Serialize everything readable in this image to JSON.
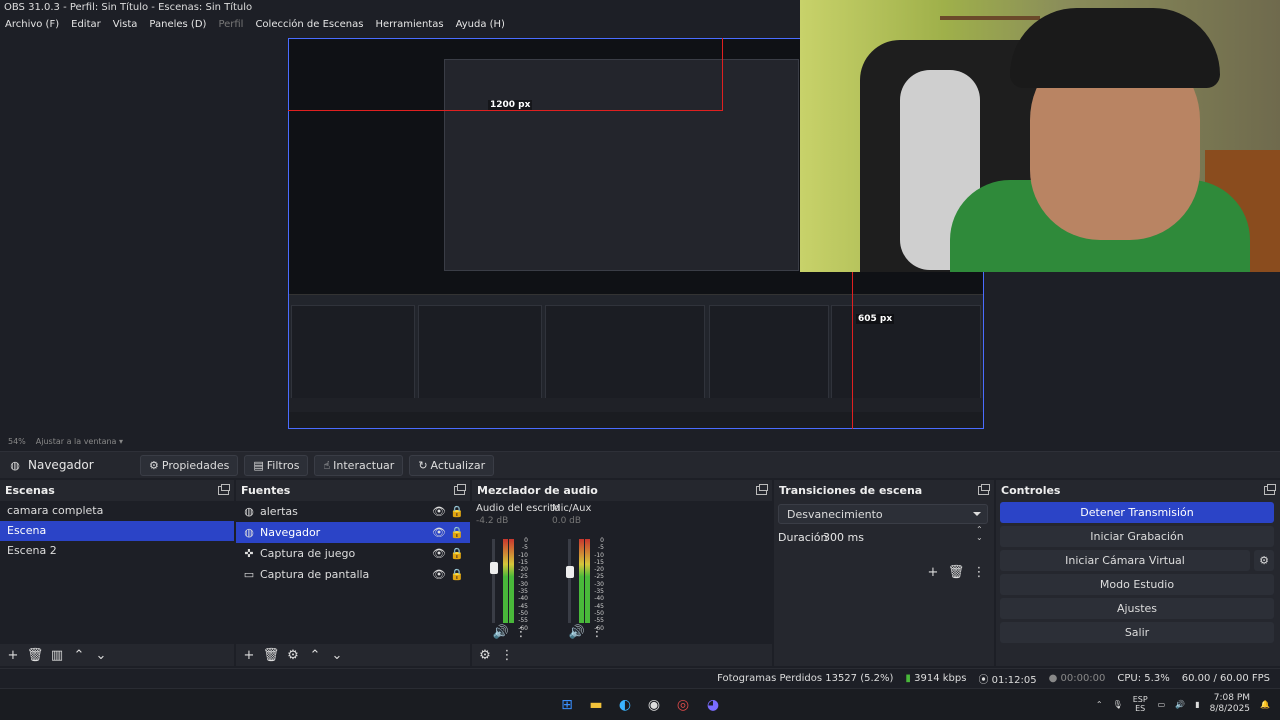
{
  "window": {
    "title": "OBS 31.0.3 - Perfil: Sin Título - Escenas: Sin Título"
  },
  "menu": [
    {
      "label": "Archivo (F)",
      "disabled": false
    },
    {
      "label": "Editar",
      "disabled": false
    },
    {
      "label": "Vista",
      "disabled": false
    },
    {
      "label": "Paneles (D)",
      "disabled": false
    },
    {
      "label": "Perfil",
      "disabled": true
    },
    {
      "label": "Colección de Escenas",
      "disabled": false
    },
    {
      "label": "Herramientas",
      "disabled": false
    },
    {
      "label": "Ayuda (H)",
      "disabled": false
    }
  ],
  "preview": {
    "guide_width_label": "1200 px",
    "guide_height_label": "605 px",
    "zoom_label": "54%",
    "fit_label": "Ajustar a la ventana"
  },
  "source_toolbar": {
    "source_name": "Navegador",
    "properties": "Propiedades",
    "filters": "Filtros",
    "interact": "Interactuar",
    "refresh": "Actualizar"
  },
  "scenes": {
    "title": "Escenas",
    "items": [
      "camara completa",
      "Escena",
      "Escena 2"
    ],
    "selected_index": 1
  },
  "sources": {
    "title": "Fuentes",
    "items": [
      {
        "name": "alertas",
        "icon": "globe-icon"
      },
      {
        "name": "Navegador",
        "icon": "globe-icon"
      },
      {
        "name": "Captura de juego",
        "icon": "gamepad-icon"
      },
      {
        "name": "Captura de pantalla",
        "icon": "monitor-icon"
      }
    ],
    "selected_index": 1
  },
  "mixer": {
    "title": "Mezclador de audio",
    "channels": [
      {
        "name": "Audio del escrito",
        "db": "-4.2 dB",
        "level": 0.85
      },
      {
        "name": "Mic/Aux",
        "db": "0.0 dB",
        "level": 0.8
      }
    ],
    "scale": [
      "0",
      "-5",
      "-10",
      "-15",
      "-20",
      "-25",
      "-30",
      "-35",
      "-40",
      "-45",
      "-50",
      "-55",
      "-60"
    ]
  },
  "transitions": {
    "title": "Transiciones de escena",
    "selected": "Desvanecimiento",
    "duration_label": "Duración",
    "duration_value": "300 ms"
  },
  "controls": {
    "title": "Controles",
    "stop_stream": "Detener Transmisión",
    "start_record": "Iniciar Grabación",
    "start_virtual_cam": "Iniciar Cámara Virtual",
    "studio_mode": "Modo Estudio",
    "settings": "Ajustes",
    "exit": "Salir"
  },
  "status": {
    "dropped_frames": "Fotogramas Perdidos 13527 (5.2%)",
    "bitrate": "3914 kbps",
    "stream_time": "01:12:05",
    "record_time": "00:00:00",
    "cpu": "CPU: 5.3%",
    "fps": "60.00 / 60.00 FPS"
  },
  "taskbar": {
    "lang_top": "ESP",
    "lang_bottom": "ES",
    "time": "7:08 PM",
    "date": "8/8/2025"
  },
  "colors": {
    "accent": "#2b44c7",
    "guide": "#e02020",
    "meter_green": "#49b83a"
  }
}
